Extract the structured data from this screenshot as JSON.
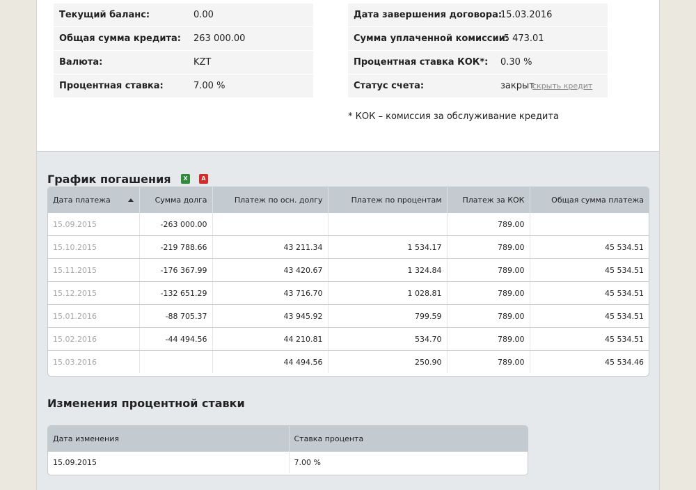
{
  "loan_info": {
    "left": [
      {
        "label": "Текущий баланс:",
        "value": "0.00"
      },
      {
        "label": "Общая сумма кредита:",
        "value": "263 000.00"
      },
      {
        "label": "Валюта:",
        "value": "KZT"
      },
      {
        "label": "Процентная ставка:",
        "value": "7.00 %"
      }
    ],
    "right": [
      {
        "label": "Дата завершения договора:",
        "value": "15.03.2016"
      },
      {
        "label": "Сумма уплаченной комиссии:",
        "value": "-5 473.01"
      },
      {
        "label": "Процентная ставка КОК*:",
        "value": "0.30 %"
      },
      {
        "label": "Статус счета:",
        "value": "закрыт"
      }
    ],
    "hide_link": "скрыть кредит",
    "footnote": "* КОК – комиссия за обслуживание кредита"
  },
  "schedule": {
    "title": "График погашения",
    "export_icons": [
      "excel-icon",
      "pdf-icon"
    ],
    "columns": [
      "Дата платежа",
      "Сумма долга",
      "Платеж по осн. долгу",
      "Платеж по процентам",
      "Платеж за КОК",
      "Общая сумма платежа"
    ],
    "rows": [
      [
        "15.09.2015",
        "-263 000.00",
        "",
        "",
        "789.00",
        ""
      ],
      [
        "15.10.2015",
        "-219 788.66",
        "43 211.34",
        "1 534.17",
        "789.00",
        "45 534.51"
      ],
      [
        "15.11.2015",
        "-176 367.99",
        "43 420.67",
        "1 324.84",
        "789.00",
        "45 534.51"
      ],
      [
        "15.12.2015",
        "-132 651.29",
        "43 716.70",
        "1 028.81",
        "789.00",
        "45 534.51"
      ],
      [
        "15.01.2016",
        "-88 705.37",
        "43 945.92",
        "799.59",
        "789.00",
        "45 534.51"
      ],
      [
        "15.02.2016",
        "-44 494.56",
        "44 210.81",
        "534.70",
        "789.00",
        "45 534.51"
      ],
      [
        "15.03.2016",
        "",
        "44 494.56",
        "250.90",
        "789.00",
        "45 534.46"
      ]
    ]
  },
  "rate_changes": {
    "title": "Изменения процентной ставки",
    "columns": [
      "Дата изменения",
      "Ставка процента"
    ],
    "rows": [
      [
        "15.09.2015",
        "7.00 %"
      ]
    ]
  },
  "colors": {
    "page_bg": "#ebe8e0",
    "panel_bg": "#e6e9eb",
    "table_header": "#c3cbd1",
    "excel_icon": "#2e8b3a",
    "pdf_icon": "#d42a2a"
  }
}
